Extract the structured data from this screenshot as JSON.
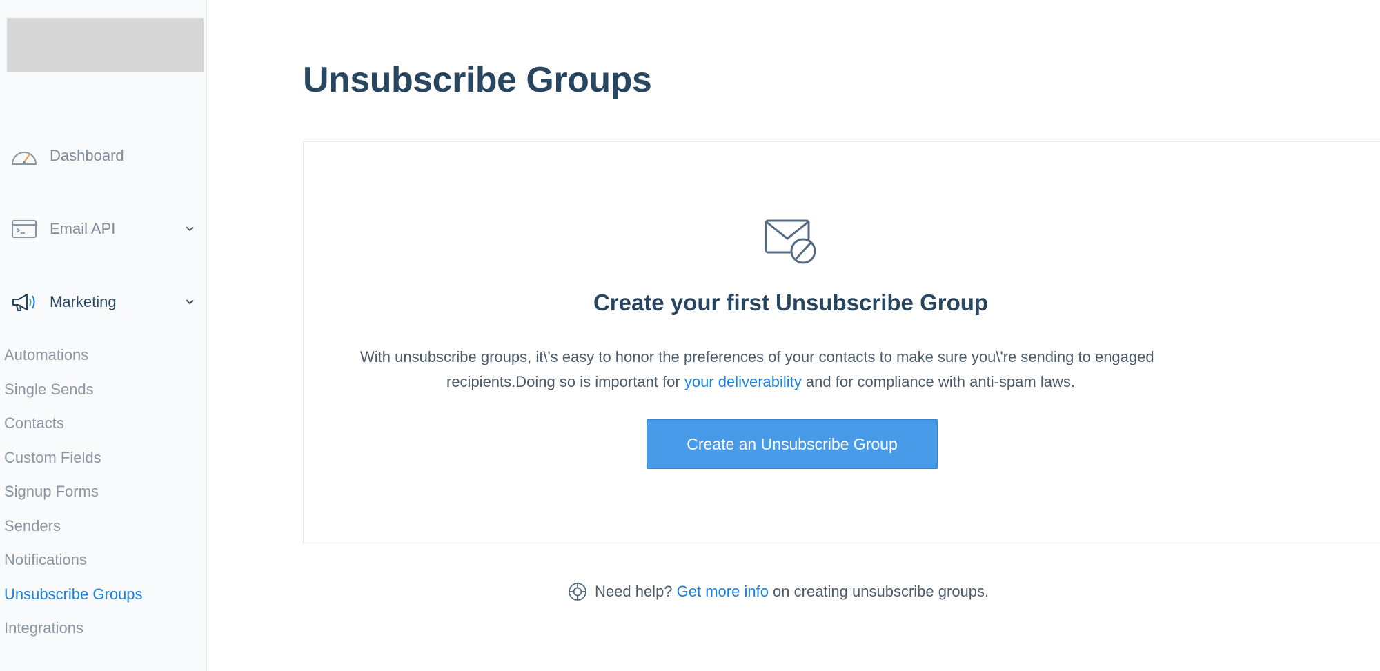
{
  "sidebar": {
    "nav": {
      "dashboard": {
        "label": "Dashboard",
        "icon": "speedometer-icon"
      },
      "email_api": {
        "label": "Email API",
        "icon": "terminal-window-icon"
      },
      "marketing": {
        "label": "Marketing",
        "icon": "megaphone-icon"
      }
    },
    "marketing_items": [
      {
        "label": "Automations"
      },
      {
        "label": "Single Sends"
      },
      {
        "label": "Contacts"
      },
      {
        "label": "Custom Fields"
      },
      {
        "label": "Signup Forms"
      },
      {
        "label": "Senders"
      },
      {
        "label": "Notifications"
      },
      {
        "label": "Unsubscribe Groups",
        "active": true
      },
      {
        "label": "Integrations"
      }
    ]
  },
  "main": {
    "title": "Unsubscribe Groups",
    "empty_state": {
      "icon": "envelope-blocked-icon",
      "title": "Create your first Unsubscribe Group",
      "desc_line1": "With unsubscribe groups, it\\'s easy to honor the preferences of your contacts  to make sure you\\'re sending to engaged",
      "desc_line2_a": "recipients.Doing so is important  for ",
      "desc_line2_link": "your deliverability",
      "desc_line2_b": " and for compliance with anti-spam laws.",
      "button_label": "Create an Unsubscribe Group"
    },
    "help": {
      "icon": "lifebuoy-icon",
      "prefix": "Need help? ",
      "link": "Get more info",
      "suffix": " on creating unsubscribe groups."
    }
  },
  "colors": {
    "accent": "#1a82e2",
    "button": "#489be8",
    "heading": "#294661",
    "muted": "#8a96a3"
  }
}
